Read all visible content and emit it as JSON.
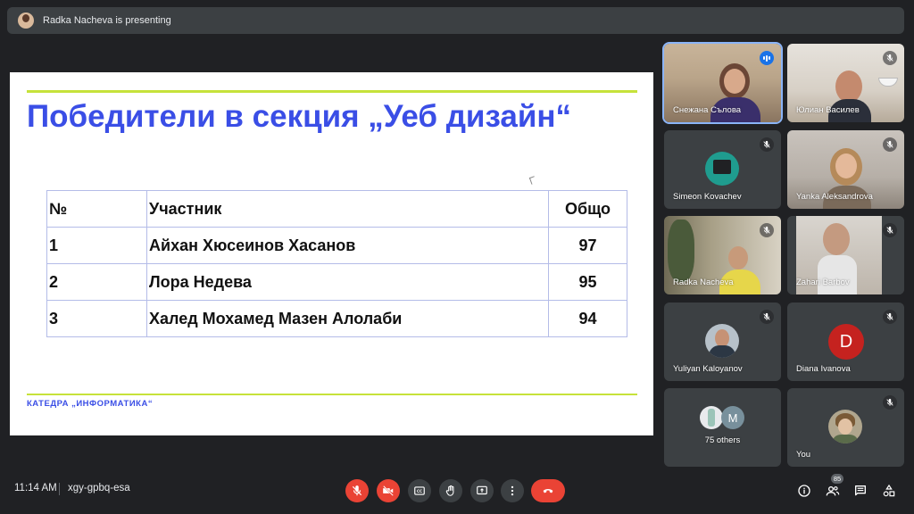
{
  "presenting": {
    "text": "Radka Nacheva is presenting"
  },
  "slide": {
    "title": "Победители в секция „Уеб дизайн“",
    "table": {
      "headers": [
        "№",
        "Участник",
        "Общо"
      ],
      "rows": [
        [
          "1",
          "Айхан Хюсеинов Хасанов",
          "97"
        ],
        [
          "2",
          "Лора Недева",
          "95"
        ],
        [
          "3",
          "Халед Мохамед Мазен Алолаби",
          "94"
        ]
      ]
    },
    "footer": "КАТЕДРА „ИНФОРМАТИКА“"
  },
  "participants": [
    {
      "name": "Снежана Сълова",
      "state": "speaking"
    },
    {
      "name": "Юлиан Василев",
      "state": "muted"
    },
    {
      "name": "Simeon Kovachev",
      "state": "muted"
    },
    {
      "name": "Yanka Aleksandrova",
      "state": "muted"
    },
    {
      "name": "Radka Nacheva",
      "state": "muted"
    },
    {
      "name": "Zahari Barbov",
      "state": "muted"
    },
    {
      "name": "Yuliyan Kaloyanov",
      "state": "muted"
    },
    {
      "name": "Diana Ivanova",
      "state": "muted",
      "avatar_letter": "D"
    },
    {
      "name": "75 others",
      "avatar_letter": "M"
    },
    {
      "name": "You",
      "state": "muted"
    }
  ],
  "bottom": {
    "time": "11:14 AM",
    "meeting_code": "xgy-gpbq-esa",
    "people_count": "85"
  },
  "icons": {
    "mic": "mic-off-icon",
    "camera": "camera-off-icon",
    "captions": "captions-icon",
    "hand": "raise-hand-icon",
    "present": "present-screen-icon",
    "more": "more-options-icon",
    "end": "end-call-icon",
    "info": "info-icon",
    "people": "people-icon",
    "chat": "chat-icon",
    "activities": "activities-icon"
  },
  "colors": {
    "background": "#202124",
    "tile": "#3c4043",
    "title_blue": "#3a4ee6",
    "accent_line": "#c6e23a",
    "danger": "#ea4335",
    "speaking": "#1a73e8"
  }
}
